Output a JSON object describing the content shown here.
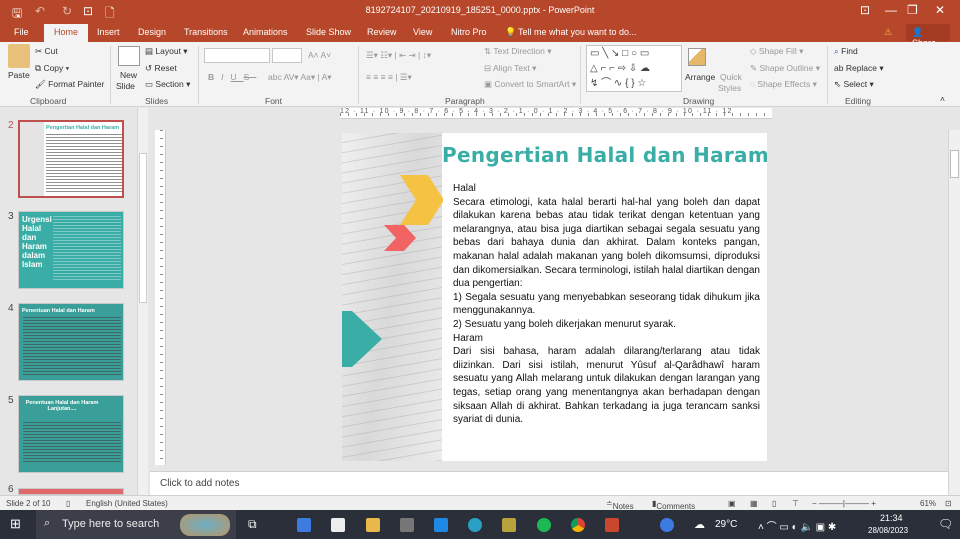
{
  "window": {
    "title": "8192724107_20210919_185251_0000.pptx - PowerPoint"
  },
  "tabs": [
    "File",
    "Home",
    "Insert",
    "Design",
    "Transitions",
    "Animations",
    "Slide Show",
    "Review",
    "View",
    "Nitro Pro"
  ],
  "tell_me": "Tell me what you want to do...",
  "share": "Share",
  "ribbon": {
    "clipboard": {
      "paste": "Paste",
      "cut": "Cut",
      "copy": "Copy",
      "format_painter": "Format Painter",
      "label": "Clipboard"
    },
    "slides": {
      "new_slide": "New",
      "new_slide2": "Slide",
      "layout": "Layout",
      "reset": "Reset",
      "section": "Section",
      "label": "Slides"
    },
    "font": {
      "label": "Font",
      "bold": "B",
      "italic": "I",
      "underline": "U",
      "strike": "S"
    },
    "paragraph": {
      "text_direction": "Text Direction",
      "align_text": "Align Text",
      "convert": "Convert to SmartArt",
      "label": "Paragraph"
    },
    "drawing": {
      "arrange": "Arrange",
      "quick": "Quick",
      "styles": "Styles",
      "shape_fill": "Shape Fill",
      "shape_outline": "Shape Outline",
      "shape_effects": "Shape Effects",
      "label": "Drawing"
    },
    "editing": {
      "find": "Find",
      "replace": "Replace",
      "select": "Select",
      "label": "Editing"
    }
  },
  "thumbnails": [
    {
      "num": "2",
      "title": "Pengertian Halal dan Haram"
    },
    {
      "num": "3",
      "title": "Urgensi Halal dan Haram dalam Islam"
    },
    {
      "num": "4",
      "title": "Penentuan Halal dan Haram"
    },
    {
      "num": "5",
      "title": "Penentuan Halal dan Haram Lanjutan...."
    },
    {
      "num": "6",
      "title": ""
    }
  ],
  "ruler": "12 · 11 · 10 · 9 · 8 · 7 · 6 · 5 · 4 · 3 · 2 · 1 · 0 · 1 · 2 · 3 · 4 · 5 · 6 · 7 · 8 · 9 · 10 · 11 · 12",
  "slide": {
    "title": "Pengertian Halal dan Haram",
    "paragraphs": [
      "Halal",
      "Secara etimologi, kata halal berarti hal-hal yang boleh dan dapat dilakukan karena bebas atau tidak terikat dengan ketentuan yang melarangnya, atau bisa juga diartikan sebagai segala sesuatu yang bebas dari bahaya dunia dan akhirat. Dalam konteks pangan, makanan halal adalah makanan yang boleh dikomsumsi, diproduksi dan dikomersialkan. Secara terminologi, istilah halal diartikan dengan dua pengertian:",
      "1)  Segala sesuatu yang menyebabkan seseorang tidak dihukum jika menggunakannya.",
      "2)  Sesuatu yang boleh dikerjakan menurut syarak.",
      "Haram",
      "Dari sisi bahasa, haram adalah dilarang/terlarang atau tidak diizinkan. Dari sisi istilah, menurut Yûsuf al-Qarâdhawî haram sesuatu yang Allah melarang untuk dilakukan dengan larangan yang tegas, setiap orang yang menentangnya akan berhadapan dengan siksaan Allah di akhirat. Bahkan terkadang ia juga terancam sanksi syariat di dunia."
    ],
    "colors": {
      "teal": "#3aaea6",
      "yellow": "#f6c244",
      "coral": "#f26464"
    }
  },
  "notes_placeholder": "Click to add notes",
  "status": {
    "slide": "Slide 2 of 10",
    "language": "English (United States)",
    "notes": "Notes",
    "comments": "Comments",
    "zoom": "61%"
  },
  "taskbar": {
    "search": "Type here to search",
    "weather": "29°C",
    "time": "21:34",
    "date": "28/08/2023"
  }
}
